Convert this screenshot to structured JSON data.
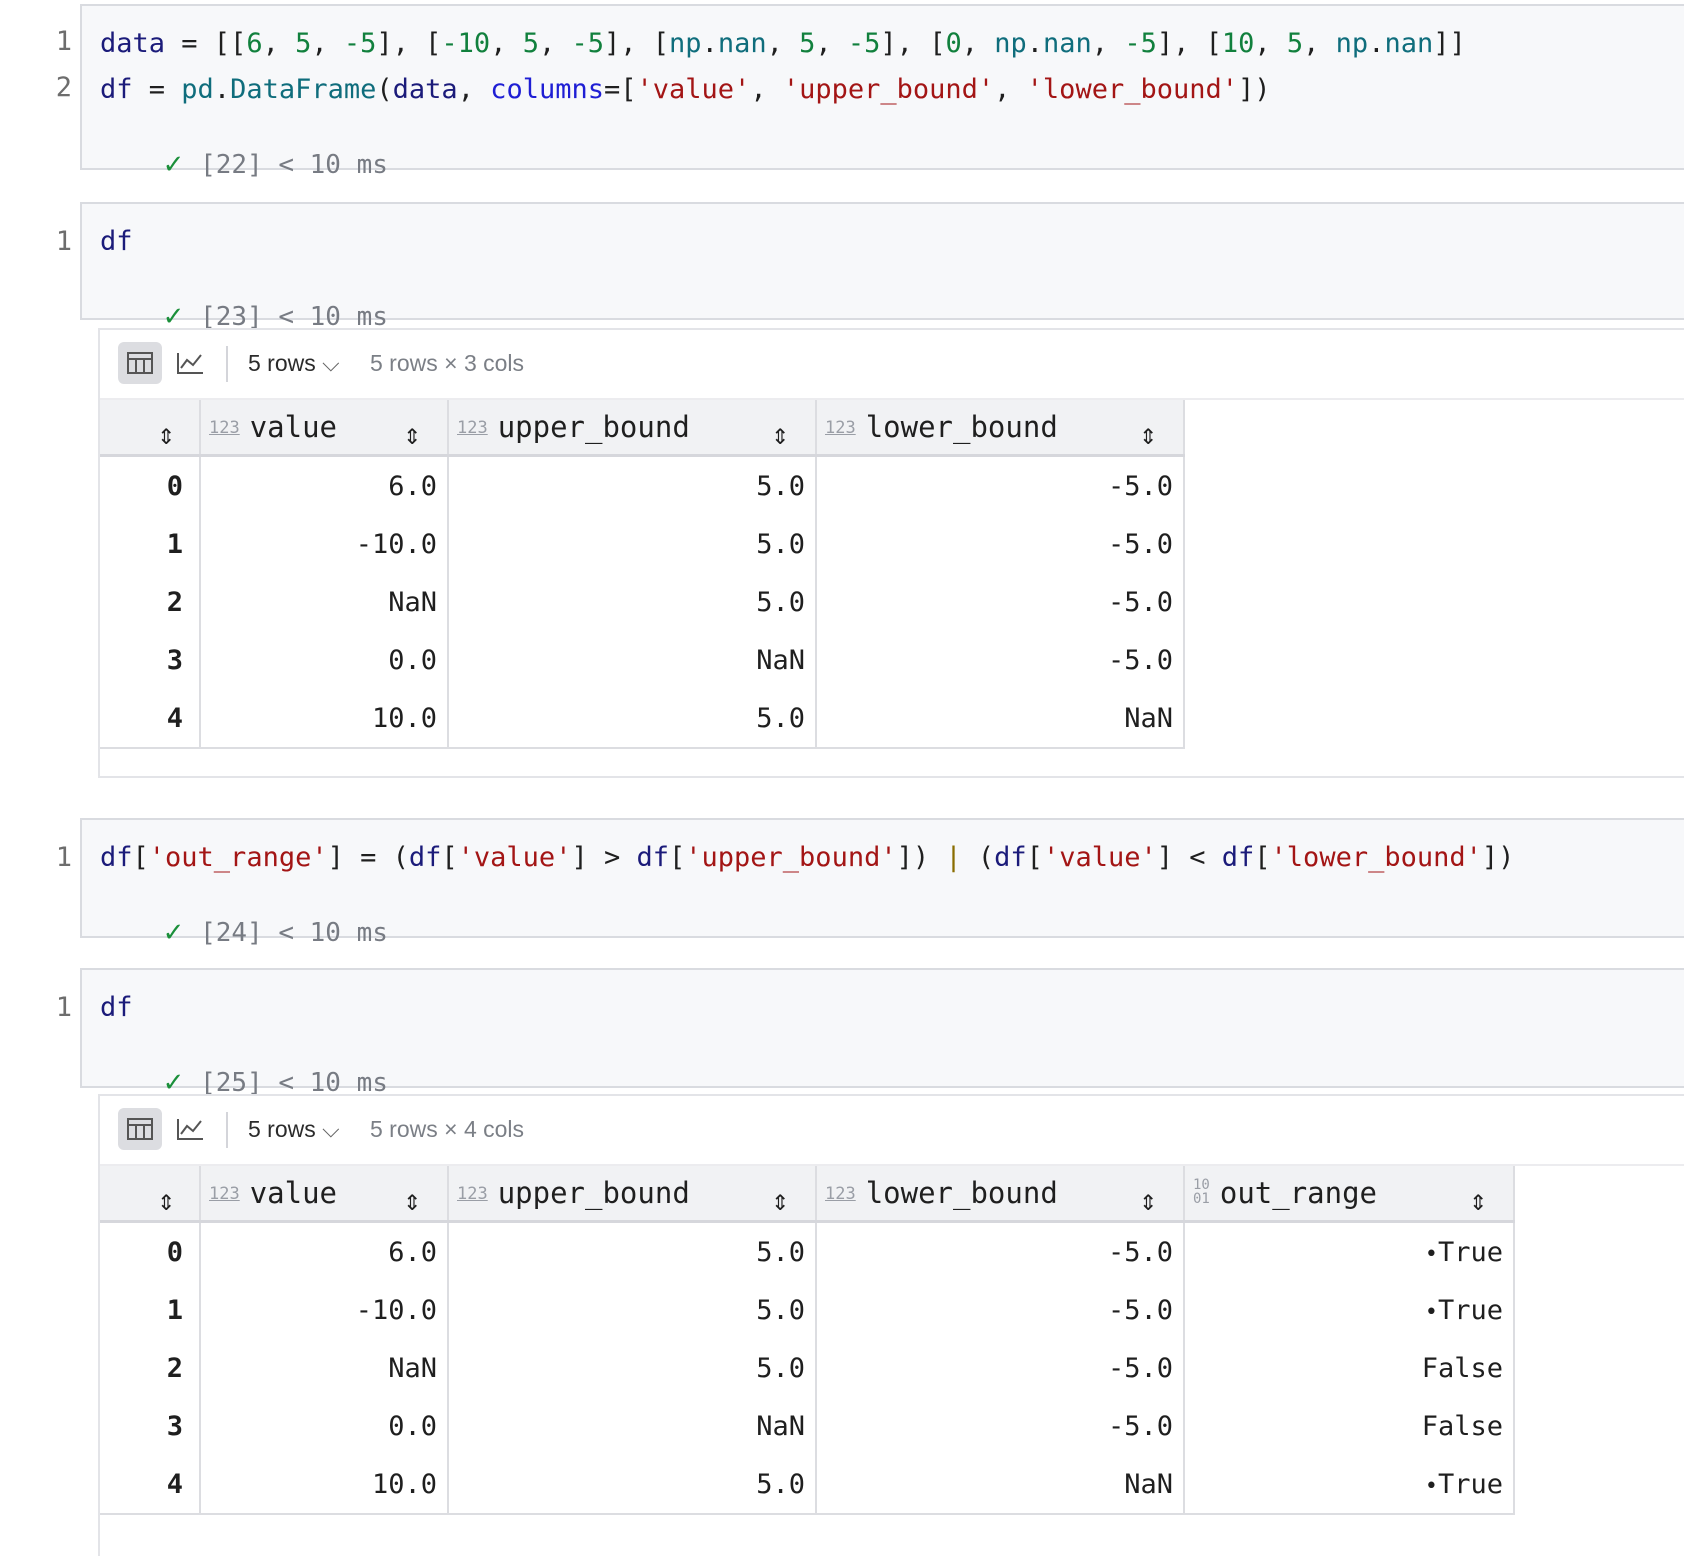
{
  "cells": [
    {
      "lines": [
        "1",
        "2"
      ],
      "status": "[22] < 10 ms"
    },
    {
      "lines": [
        "1"
      ],
      "code": "df",
      "status": "[23] < 10 ms"
    },
    {
      "lines": [
        "1"
      ],
      "status": "[24] < 10 ms"
    },
    {
      "lines": [
        "1"
      ],
      "code": "df",
      "status": "[25] < 10 ms"
    }
  ],
  "output1": {
    "rows_label": "5 rows",
    "dims": "5 rows × 3 cols",
    "type_label": "123",
    "columns": [
      "value",
      "upper_bound",
      "lower_bound"
    ],
    "rows": [
      {
        "idx": "0",
        "value": "6.0",
        "upper": "5.0",
        "lower": "-5.0"
      },
      {
        "idx": "1",
        "value": "-10.0",
        "upper": "5.0",
        "lower": "-5.0"
      },
      {
        "idx": "2",
        "value": "NaN",
        "upper": "5.0",
        "lower": "-5.0"
      },
      {
        "idx": "3",
        "value": "0.0",
        "upper": "NaN",
        "lower": "-5.0"
      },
      {
        "idx": "4",
        "value": "10.0",
        "upper": "5.0",
        "lower": "NaN"
      }
    ]
  },
  "output2": {
    "rows_label": "5 rows",
    "dims": "5 rows × 4 cols",
    "type_label": "123",
    "bool_type_top": "10",
    "bool_type_bottom": "01",
    "columns": [
      "value",
      "upper_bound",
      "lower_bound",
      "out_range"
    ],
    "rows": [
      {
        "idx": "0",
        "value": "6.0",
        "upper": "5.0",
        "lower": "-5.0",
        "out": "True",
        "mark": "•"
      },
      {
        "idx": "1",
        "value": "-10.0",
        "upper": "5.0",
        "lower": "-5.0",
        "out": "True",
        "mark": "•"
      },
      {
        "idx": "2",
        "value": "NaN",
        "upper": "5.0",
        "lower": "-5.0",
        "out": "False",
        "mark": ""
      },
      {
        "idx": "3",
        "value": "0.0",
        "upper": "NaN",
        "lower": "-5.0",
        "out": "False",
        "mark": ""
      },
      {
        "idx": "4",
        "value": "10.0",
        "upper": "5.0",
        "lower": "NaN",
        "out": "True",
        "mark": "•"
      }
    ]
  },
  "code_tokens": {
    "c1l1": [
      "data",
      " = [[",
      "6",
      ", ",
      "5",
      ", ",
      "-5",
      "], [",
      "-10",
      ", ",
      "5",
      ", ",
      "-5",
      "], [",
      "np",
      ".",
      "nan",
      ", ",
      "5",
      ", ",
      "-5",
      "], [",
      "0",
      ", ",
      "np",
      ".",
      "nan",
      ", ",
      "-5",
      "], [",
      "10",
      ", ",
      "5",
      ", ",
      "np",
      ".",
      "nan",
      "]]"
    ],
    "c1l2": [
      "df",
      " = ",
      "pd",
      ".",
      "DataFrame",
      "(",
      "data",
      ", ",
      "columns",
      "=[",
      "'value'",
      ", ",
      "'upper_bound'",
      ", ",
      "'lower_bound'",
      "])"
    ],
    "c3l1": [
      "df",
      "[",
      "'out_range'",
      "] = (",
      "df",
      "[",
      "'value'",
      "] > ",
      "df",
      "[",
      "'upper_bound'",
      "]) ",
      "|",
      " (",
      "df",
      "[",
      "'value'",
      "] < ",
      "df",
      "[",
      "'lower_bound'",
      "])"
    ]
  },
  "token_kinds": {
    "c1l1": [
      "var",
      "",
      "num",
      "",
      "num",
      "",
      "num",
      "",
      "num",
      "",
      "num",
      "",
      "num",
      "",
      "mod",
      "",
      "mod",
      "",
      "num",
      "",
      "num",
      "",
      "num",
      "",
      "mod",
      "",
      "mod",
      "",
      "num",
      "",
      "num",
      "",
      "num",
      "",
      "mod",
      "",
      "mod",
      ""
    ],
    "c1l2": [
      "var",
      "",
      "mod",
      "",
      "mod",
      "",
      "var",
      "",
      "par",
      "",
      "str",
      "",
      "str",
      "",
      "str",
      ""
    ],
    "c3l1": [
      "var",
      "",
      "str",
      "",
      "var",
      "",
      "str",
      "",
      "var",
      "",
      "str",
      "",
      "op",
      "",
      "var",
      "",
      "str",
      "",
      "var",
      "",
      "str",
      ""
    ]
  }
}
